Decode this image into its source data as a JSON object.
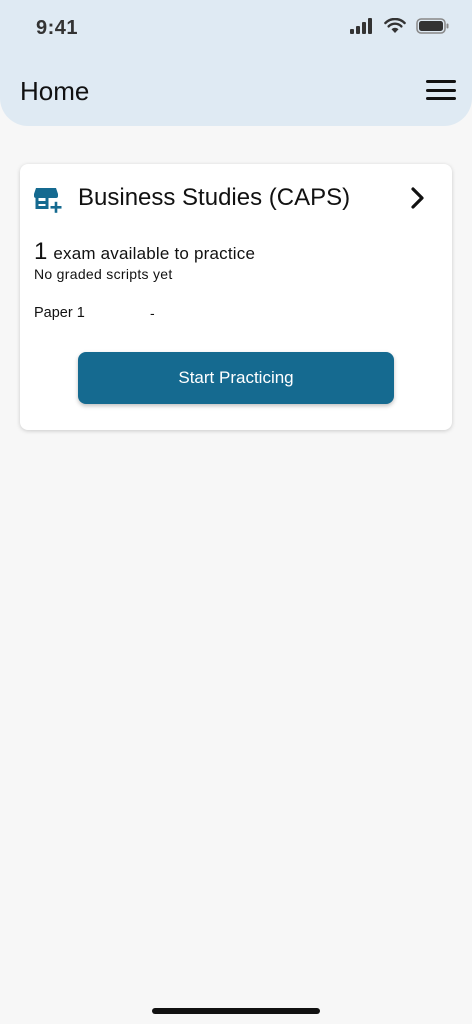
{
  "status_bar": {
    "time": "9:41"
  },
  "header": {
    "title": "Home"
  },
  "card": {
    "title": "Business Studies (CAPS)",
    "exam_count": "1",
    "exam_text": "exam available to practice",
    "graded_text": "No graded scripts yet",
    "papers": [
      {
        "name": "Paper 1",
        "score": "-"
      }
    ],
    "start_label": "Start Practicing",
    "icon": "store-add-icon"
  },
  "colors": {
    "header_bg": "#dfeaf3",
    "accent": "#156a90",
    "background": "#f7f7f7"
  }
}
